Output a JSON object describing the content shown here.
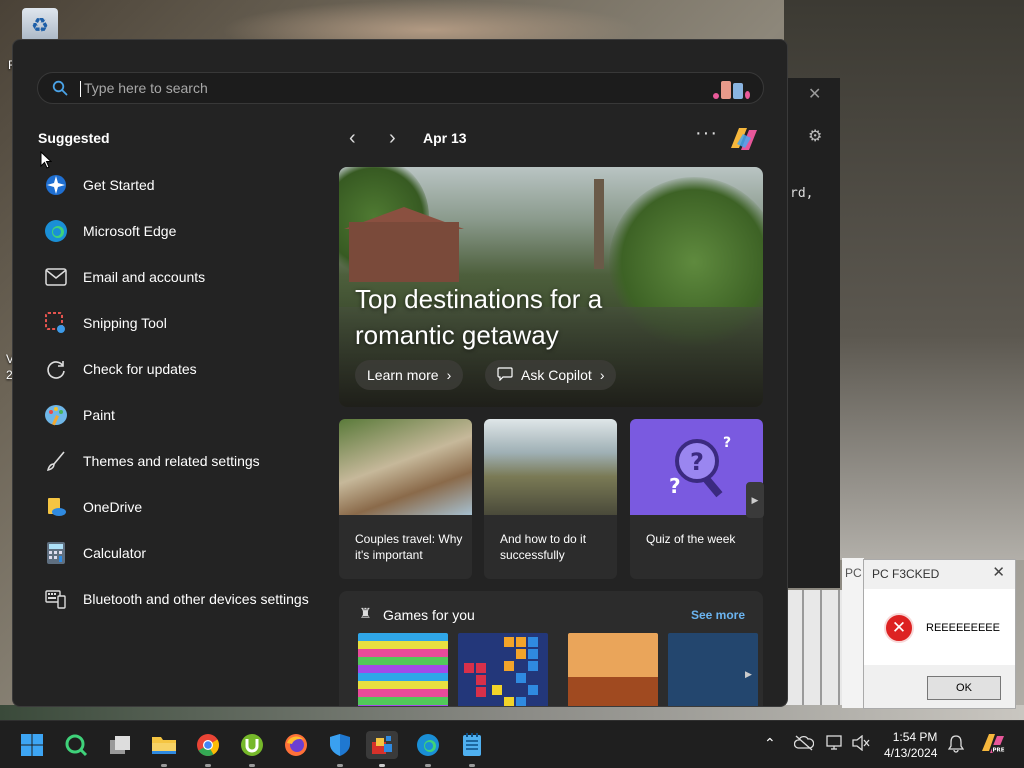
{
  "desktop": {
    "icons": [
      {
        "name": "recycle-bin-icon"
      }
    ],
    "label_r": "R",
    "label_v": "V",
    "label_2": "2"
  },
  "background_window": {
    "text": "rd,"
  },
  "background_window2": {
    "tab": "PC"
  },
  "error_dialog": {
    "title": "PC F3CKED",
    "message": "REEEEEEEEE",
    "ok_label": "OK"
  },
  "start_menu": {
    "search_placeholder": "Type here to search",
    "suggested_label": "Suggested",
    "apps": [
      {
        "label": "Get Started",
        "icon": "get-started-icon"
      },
      {
        "label": "Microsoft Edge",
        "icon": "edge-icon"
      },
      {
        "label": "Email and accounts",
        "icon": "mail-icon"
      },
      {
        "label": "Snipping Tool",
        "icon": "snipping-tool-icon"
      },
      {
        "label": "Check for updates",
        "icon": "refresh-icon"
      },
      {
        "label": "Paint",
        "icon": "paint-icon"
      },
      {
        "label": "Themes and related settings",
        "icon": "brush-icon"
      },
      {
        "label": "OneDrive",
        "icon": "onedrive-icon"
      },
      {
        "label": "Calculator",
        "icon": "calculator-icon"
      },
      {
        "label": "Bluetooth and other devices settings",
        "icon": "devices-icon"
      }
    ],
    "date": "Apr 13",
    "more_label": "···",
    "hero": {
      "title": "Top destinations for a romantic getaway",
      "learn_more": "Learn more",
      "ask_copilot": "Ask Copilot"
    },
    "cards": [
      {
        "text": "Couples travel: Why it's important"
      },
      {
        "text": "And how to do it successfully"
      },
      {
        "text": "Quiz of the week"
      }
    ],
    "games": {
      "title": "Games for you",
      "see_more": "See more"
    }
  },
  "taskbar": {
    "apps": [
      "start-button",
      "search-icon",
      "task-view-icon",
      "file-explorer-icon",
      "chrome-icon",
      "utorrent-icon",
      "firefox-icon",
      "defender-icon",
      "app-icon",
      "edge-icon",
      "notepad-icon"
    ],
    "time": "1:54 PM",
    "date": "4/13/2024"
  },
  "colors": {
    "accent": "#6bb4f0",
    "start_bg": "#232323",
    "card_bg": "#2c2c2c",
    "error_red": "#dd2222"
  }
}
